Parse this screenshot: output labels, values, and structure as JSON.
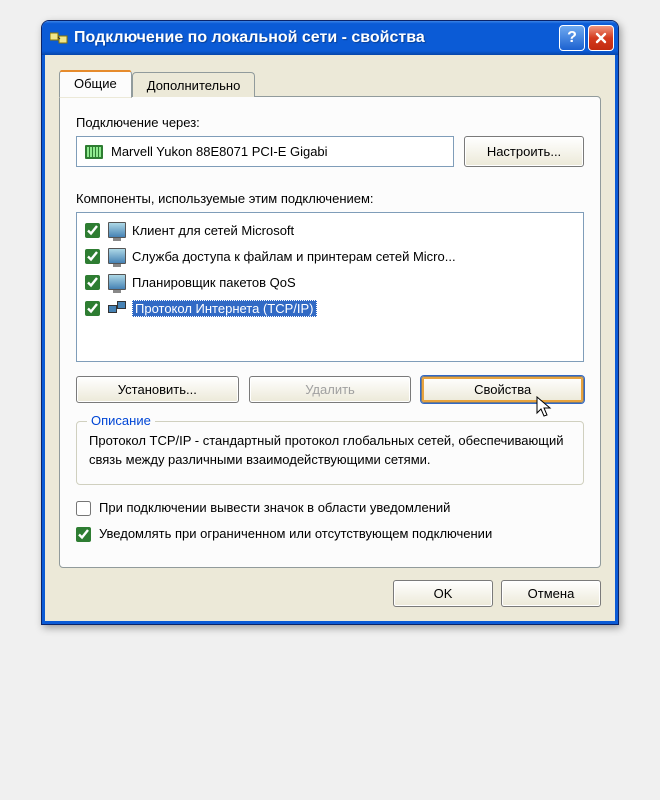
{
  "window": {
    "title": "Подключение по локальной сети - свойства"
  },
  "tabs": {
    "general": "Общие",
    "advanced": "Дополнительно"
  },
  "connectUsing": {
    "label": "Подключение через:",
    "adapter": "Marvell Yukon 88E8071 PCI-E Gigabi",
    "configure": "Настроить..."
  },
  "components": {
    "label": "Компоненты, используемые этим подключением:",
    "items": [
      "Клиент для сетей Microsoft",
      "Служба доступа к файлам и принтерам сетей Micro...",
      "Планировщик пакетов QoS",
      "Протокол Интернета (TCP/IP)"
    ]
  },
  "actions": {
    "install": "Установить...",
    "remove": "Удалить",
    "properties": "Свойства"
  },
  "description": {
    "title": "Описание",
    "text": "Протокол TCP/IP - стандартный протокол глобальных сетей, обеспечивающий связь между различными взаимодействующими сетями."
  },
  "options": {
    "showIcon": "При подключении вывести значок в области уведомлений",
    "notifyLimited": "Уведомлять при ограниченном или отсутствующем подключении"
  },
  "dialogButtons": {
    "ok": "OK",
    "cancel": "Отмена"
  }
}
